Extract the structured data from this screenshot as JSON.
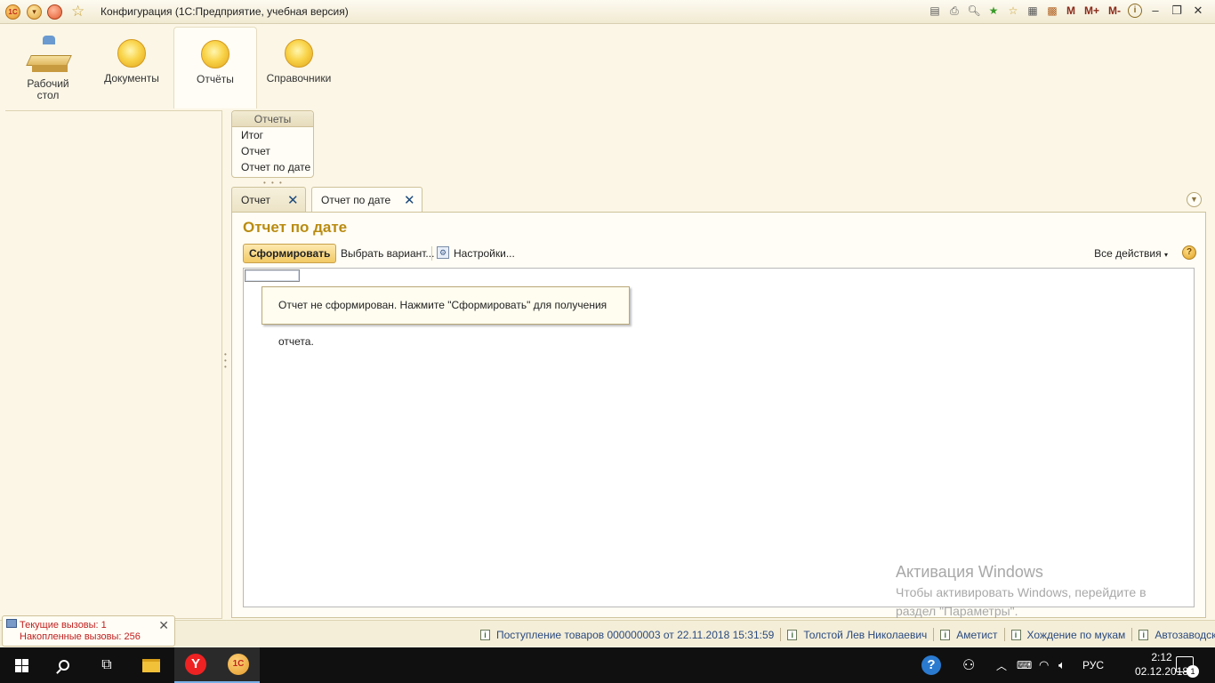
{
  "window": {
    "title": "Конфигурация  (1С:Предприятие, учебная версия)",
    "logo_text": "1С",
    "toolbar_icons": [
      "save-icon",
      "print-icon",
      "preview-icon",
      "favorites-add-icon",
      "favorites-icon",
      "calculator-icon",
      "calendar-icon"
    ],
    "memory_buttons": [
      "M",
      "M+",
      "M-"
    ],
    "info_icon": "i"
  },
  "sections": [
    {
      "label": "Рабочий\nстол",
      "icon": "desktop-icon"
    },
    {
      "label": "Документы",
      "icon": "section-icon"
    },
    {
      "label": "Отчёты",
      "icon": "section-icon"
    },
    {
      "label": "Справочники",
      "icon": "section-icon"
    }
  ],
  "reports_menu": {
    "header": "Отчеты",
    "items": [
      "Итог",
      "Отчет",
      "Отчет по дате"
    ]
  },
  "tabs": [
    {
      "label": "Отчет",
      "active": false
    },
    {
      "label": "Отчет по дате",
      "active": true
    }
  ],
  "form": {
    "title": "Отчет по дате",
    "generate_button": "Сформировать",
    "choose_variant": "Выбрать вариант...",
    "settings": "Настройки...",
    "all_actions": "Все действия",
    "help": "?",
    "message": "Отчет не сформирован. Нажмите \"Сформировать\" для получения отчета."
  },
  "watermark": {
    "title": "Активация Windows",
    "text": "Чтобы активировать Windows, перейдите в раздел \"Параметры\"."
  },
  "calls": {
    "current": "Текущие вызовы: 1",
    "accumulated": "Накопленные вызовы: 256"
  },
  "history": [
    "Поступление товаров 000000003 от 22.11.2018 15:31:59",
    "Толстой Лев Николаевич",
    "Аметист",
    "Хождение по мукам",
    "Автозаводская"
  ],
  "taskbar": {
    "language": "РУС",
    "time": "2:12",
    "date": "02.12.2018",
    "notifications": "1"
  },
  "colors": {
    "accent_title": "#b98b10",
    "background": "#fbf6e6",
    "history_link": "#2a4a80",
    "calls_text": "#c02020"
  }
}
